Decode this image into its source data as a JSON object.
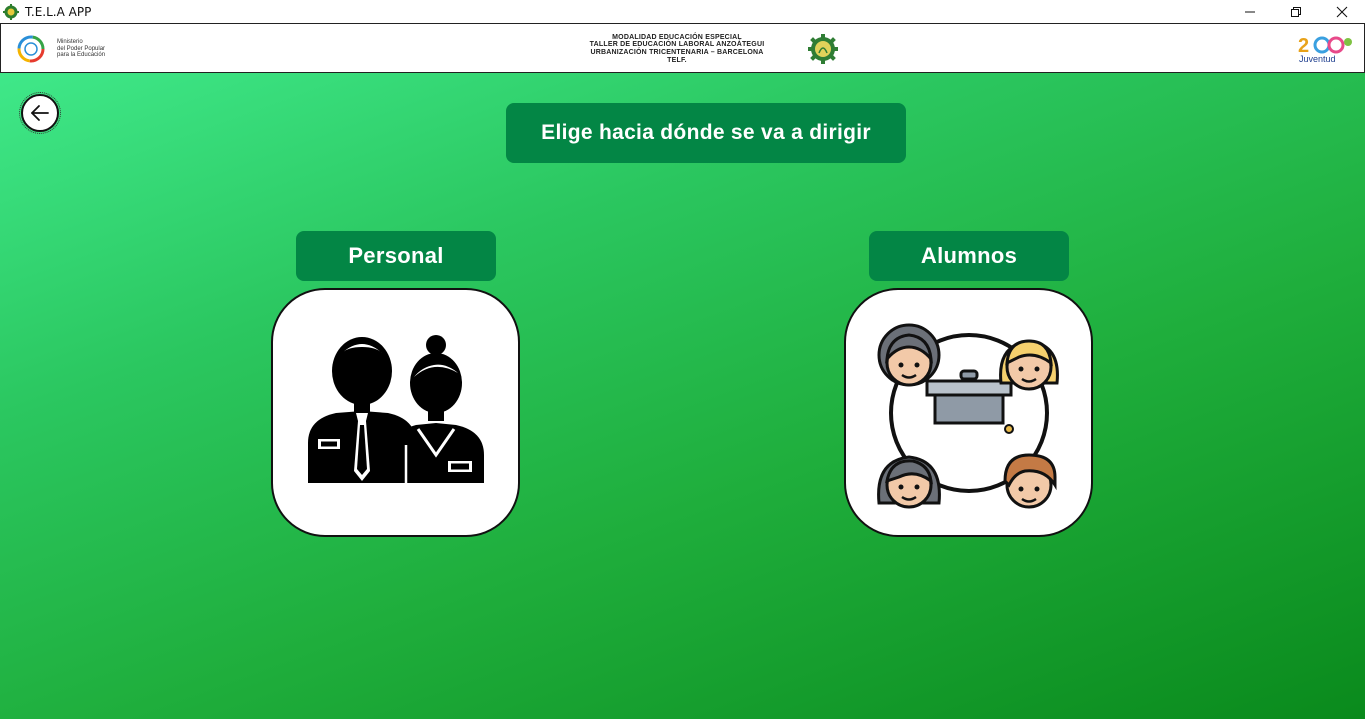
{
  "window": {
    "title": "T.E.L.A APP",
    "controls": [
      "minimize",
      "restore",
      "close"
    ]
  },
  "banner": {
    "ministry_lines": [
      "Ministerio",
      "del Poder Popular",
      "para la Educación"
    ],
    "institution_lines": [
      "MODALIDAD EDUCACIÓN ESPECIAL",
      "TALLER DE EDUCACIÓN LABORAL ANZOÁTEGUI",
      "URBANIZACIÓN TRICENTENARIA – BARCELONA",
      "TELF."
    ],
    "right_logo_text": "Juventud"
  },
  "main": {
    "heading": "Elige hacia dónde se va a dirigir",
    "options": [
      {
        "label": "Personal",
        "icon": "staff-icon"
      },
      {
        "label": "Alumnos",
        "icon": "students-icon"
      }
    ]
  },
  "colors": {
    "accent": "#038645",
    "gradient_start": "#3fe889",
    "gradient_end": "#0a8a1c"
  }
}
